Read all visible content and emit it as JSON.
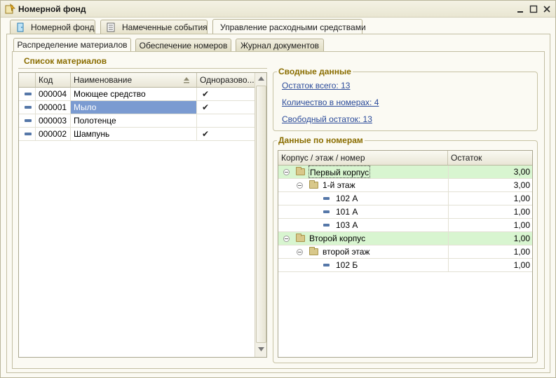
{
  "window": {
    "title": "Номерной фонд"
  },
  "tabs": [
    {
      "label": "Номерной фонд",
      "icon": "door-icon"
    },
    {
      "label": "Намеченные события",
      "icon": "events-list-icon"
    },
    {
      "label": "Управление расходными средствами",
      "active": true
    }
  ],
  "subtabs": [
    {
      "label": "Распределение материалов",
      "active": true
    },
    {
      "label": "Обеспечение номеров"
    },
    {
      "label": "Журнал документов"
    }
  ],
  "materials": {
    "title": "Список материалов",
    "columns": {
      "code": "Код",
      "name": "Наименование",
      "disposable": "Одноразово..."
    },
    "rows": [
      {
        "code": "000004",
        "name": "Моющее средство",
        "disposable": "✔"
      },
      {
        "code": "000001",
        "name": "Мыло",
        "disposable": "✔",
        "selected": true
      },
      {
        "code": "000003",
        "name": "Полотенце",
        "disposable": ""
      },
      {
        "code": "000002",
        "name": "Шампунь",
        "disposable": "✔"
      }
    ]
  },
  "summary": {
    "title": "Сводные данные",
    "links": {
      "total": "Остаток всего: 13",
      "in_rooms": "Количество в номерах: 4",
      "free": "Свободный остаток: 13"
    }
  },
  "rooms": {
    "title": "Данные по номерам",
    "columns": {
      "name": "Корпус / этаж / номер",
      "rest": "Остаток"
    },
    "rows": [
      {
        "name": "Первый корпус",
        "rest": "3,00"
      },
      {
        "name": "1-й этаж",
        "rest": "3,00"
      },
      {
        "name": "102 А",
        "rest": "1,00"
      },
      {
        "name": "101 А",
        "rest": "1,00"
      },
      {
        "name": "103 А",
        "rest": "1,00"
      },
      {
        "name": "Второй корпус",
        "rest": "1,00"
      },
      {
        "name": "второй этаж",
        "rest": "1,00"
      },
      {
        "name": "102 Б",
        "rest": "1,00"
      }
    ]
  },
  "colors": {
    "selection": "#7b9bd1",
    "building_row": "#d8f5d0",
    "section_title": "#8a6d00",
    "link": "#2b4b9a"
  }
}
